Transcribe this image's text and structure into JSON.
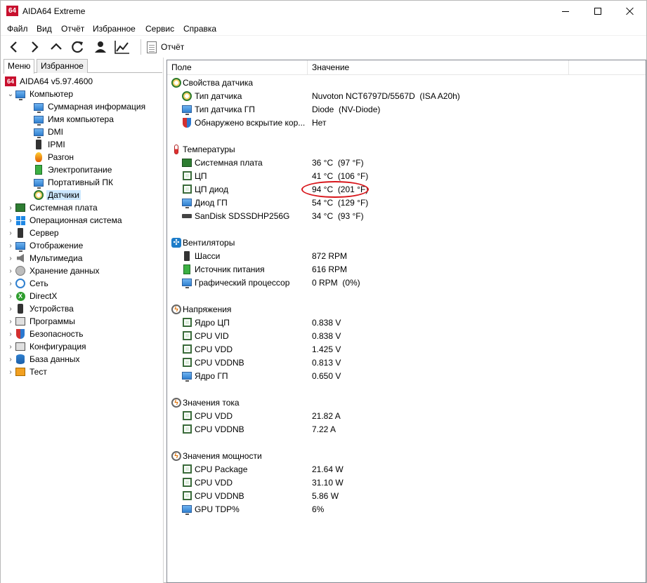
{
  "window": {
    "logo": "64",
    "title": "AIDA64 Extreme"
  },
  "menu": [
    "Файл",
    "Вид",
    "Отчёт",
    "Избранное",
    "Сервис",
    "Справка"
  ],
  "toolbar": {
    "report_label": "Отчёт"
  },
  "left_tabs": [
    "Меню",
    "Избранное"
  ],
  "tree": {
    "root": "AIDA64 v5.97.4600",
    "computer": "Компьютер",
    "computer_children": [
      "Суммарная информация",
      "Имя компьютера",
      "DMI",
      "IPMI",
      "Разгон",
      "Электропитание",
      "Портативный ПК",
      "Датчики"
    ],
    "categories": [
      "Системная плата",
      "Операционная система",
      "Сервер",
      "Отображение",
      "Мультимедиа",
      "Хранение данных",
      "Сеть",
      "DirectX",
      "Устройства",
      "Программы",
      "Безопасность",
      "Конфигурация",
      "База данных",
      "Тест"
    ]
  },
  "columns": {
    "field": "Поле",
    "value": "Значение"
  },
  "sensor_props": {
    "group": "Свойства датчика",
    "items": [
      {
        "field": "Тип датчика",
        "value": "Nuvoton NCT6797D/5567D  (ISA A20h)"
      },
      {
        "field": "Тип датчика ГП",
        "value": "Diode  (NV-Diode)"
      },
      {
        "field": "Обнаружено вскрытие кор...",
        "value": "Нет"
      }
    ]
  },
  "temperatures": {
    "group": "Температуры",
    "items": [
      {
        "field": "Системная плата",
        "value": "36 °C  (97 °F)"
      },
      {
        "field": "ЦП",
        "value": "41 °C  (106 °F)"
      },
      {
        "field": "ЦП диод",
        "value": "94 °C  (201 °F)"
      },
      {
        "field": "Диод ГП",
        "value": "54 °C  (129 °F)"
      },
      {
        "field": "SanDisk SDSSDHP256G",
        "value": "34 °C  (93 °F)"
      }
    ]
  },
  "fans": {
    "group": "Вентиляторы",
    "items": [
      {
        "field": "Шасси",
        "value": "872 RPM"
      },
      {
        "field": "Источник питания",
        "value": "616 RPM"
      },
      {
        "field": "Графический процессор",
        "value": "0 RPM  (0%)"
      }
    ]
  },
  "voltages": {
    "group": "Напряжения",
    "items": [
      {
        "field": "Ядро ЦП",
        "value": "0.838 V"
      },
      {
        "field": "CPU VID",
        "value": "0.838 V"
      },
      {
        "field": "CPU VDD",
        "value": "1.425 V"
      },
      {
        "field": "CPU VDDNB",
        "value": "0.813 V"
      },
      {
        "field": "Ядро ГП",
        "value": "0.650 V"
      }
    ]
  },
  "currents": {
    "group": "Значения тока",
    "items": [
      {
        "field": "CPU VDD",
        "value": "21.82 A"
      },
      {
        "field": "CPU VDDNB",
        "value": "7.22 A"
      }
    ]
  },
  "powers": {
    "group": "Значения мощности",
    "items": [
      {
        "field": "CPU Package",
        "value": "21.64 W"
      },
      {
        "field": "CPU VDD",
        "value": "31.10 W"
      },
      {
        "field": "CPU VDDNB",
        "value": "5.86 W"
      },
      {
        "field": "GPU TDP%",
        "value": "6%"
      }
    ]
  },
  "colors": {
    "highlight": "#d8161b",
    "selection": "#cce8ff",
    "brand": "#c8102e"
  }
}
